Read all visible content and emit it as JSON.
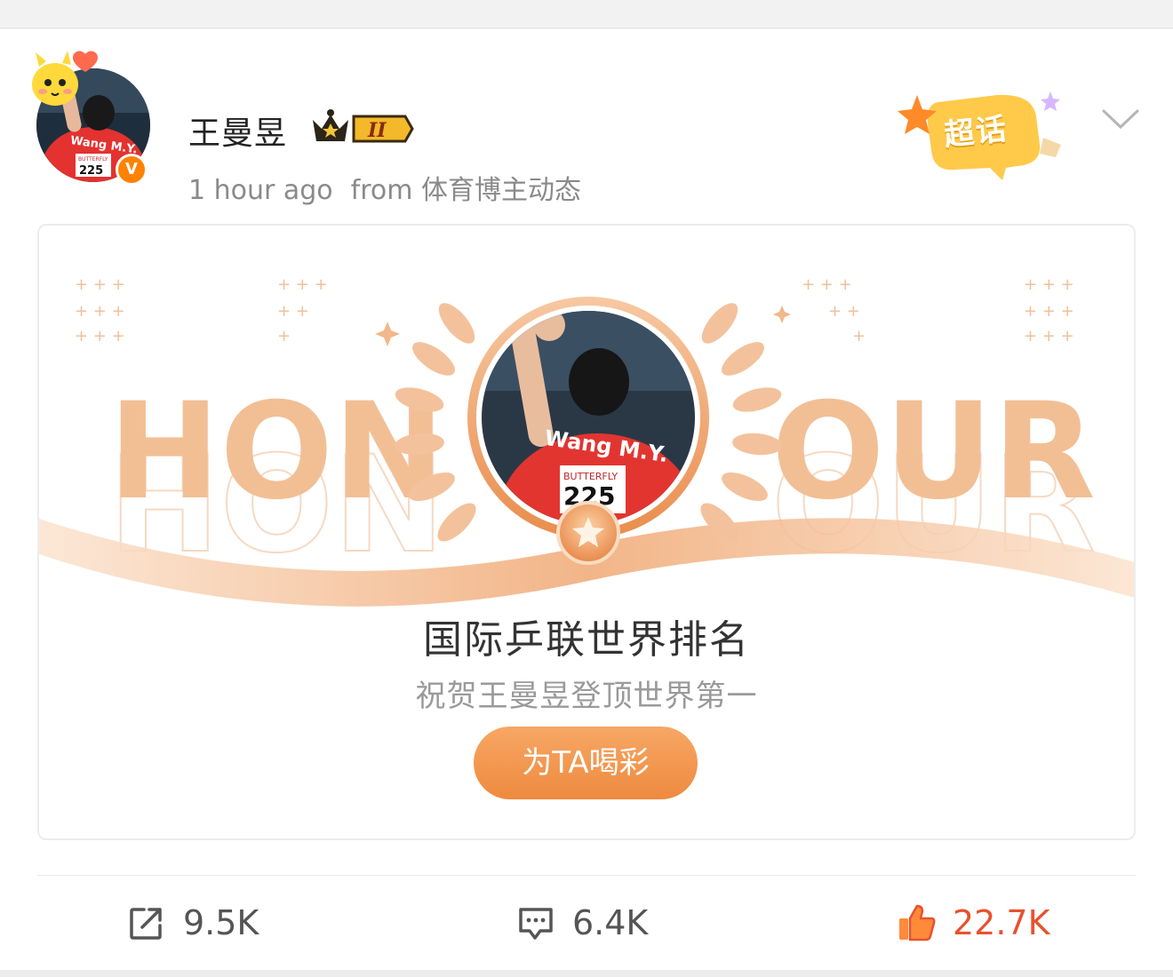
{
  "post": {
    "username": "王曼昱",
    "member_level": "II",
    "time": "1 hour ago",
    "source": "from 体育博主动态",
    "chaohua_label": "超话",
    "avatar_icons": {
      "verified": "V"
    }
  },
  "honour_card": {
    "word_left": "HON",
    "word_right": "OUR",
    "photo_text": {
      "jersey": "Wang M.Y.",
      "sponsor": "BUTTERFLY",
      "number": "225"
    },
    "title": "国际乒联世界排名",
    "subtitle": "祝贺王曼昱登顶世界第一",
    "button_label": "为TA喝彩"
  },
  "actions": {
    "repost": {
      "icon": "repost-icon",
      "count": "9.5K"
    },
    "comment": {
      "icon": "comment-icon",
      "count": "6.4K"
    },
    "like": {
      "icon": "thumbs-up-icon",
      "count": "22.7K"
    }
  },
  "colors": {
    "accent_orange": "#ff8200",
    "honour_peach": "#f2b98a",
    "like_red": "#e8512f",
    "button_orange": "#ee8a3f"
  }
}
